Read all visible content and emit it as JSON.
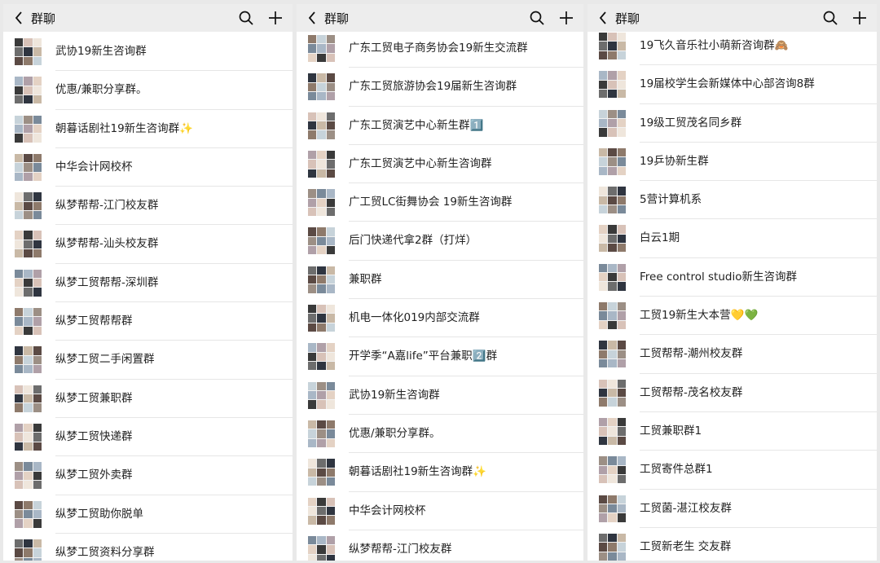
{
  "panels": [
    {
      "header": {
        "title": "群聊",
        "back_icon": "chevron-left-icon",
        "search_icon": "search-icon",
        "add_icon": "plus-icon"
      },
      "groups": [
        {
          "name": "武协19新生咨询群"
        },
        {
          "name": "优惠/兼职分享群。"
        },
        {
          "name": "朝暮话剧社19新生咨询群✨"
        },
        {
          "name": "中华会计网校杯"
        },
        {
          "name": "纵梦帮帮-江门校友群"
        },
        {
          "name": "纵梦帮帮-汕头校友群"
        },
        {
          "name": "纵梦工贸帮帮-深圳群"
        },
        {
          "name": "纵梦工贸帮帮群"
        },
        {
          "name": "纵梦工贸二手闲置群"
        },
        {
          "name": "纵梦工贸兼职群"
        },
        {
          "name": "纵梦工贸快递群"
        },
        {
          "name": "纵梦工贸外卖群"
        },
        {
          "name": "纵梦工贸助你脱单"
        },
        {
          "name": "纵梦工贸资料分享群"
        }
      ]
    },
    {
      "header": {
        "title": "群聊",
        "back_icon": "chevron-left-icon",
        "search_icon": "search-icon",
        "add_icon": "plus-icon"
      },
      "groups": [
        {
          "name": "广东工贸电子商务协会19新生交流群"
        },
        {
          "name": "广东工贸旅游协会19届新生咨询群"
        },
        {
          "name": "广东工贸演艺中心新生群1️⃣"
        },
        {
          "name": "广东工贸演艺中心新生咨询群"
        },
        {
          "name": "广工贸LC街舞协会 19新生咨询群"
        },
        {
          "name": "后门快递代拿2群（打烊）"
        },
        {
          "name": "兼职群"
        },
        {
          "name": "机电一体化019内部交流群"
        },
        {
          "name": "开学季“A嘉life”平台兼职2️⃣群"
        },
        {
          "name": "武协19新生咨询群"
        },
        {
          "name": "优惠/兼职分享群。"
        },
        {
          "name": "朝暮话剧社19新生咨询群✨"
        },
        {
          "name": "中华会计网校杯"
        },
        {
          "name": "纵梦帮帮-江门校友群"
        }
      ]
    },
    {
      "header": {
        "title": "群聊",
        "back_icon": "chevron-left-icon",
        "search_icon": "search-icon",
        "add_icon": "plus-icon"
      },
      "groups": [
        {
          "name": "19飞久音乐社小萌新咨询群🙈"
        },
        {
          "name": "19届校学生会新媒体中心部咨询8群"
        },
        {
          "name": "19级工贸茂名同乡群"
        },
        {
          "name": "19乒协新生群"
        },
        {
          "name": "5营计算机系"
        },
        {
          "name": "白云1期"
        },
        {
          "name": "Free control studio新生咨询群"
        },
        {
          "name": "工贸19新生大本营💛💚"
        },
        {
          "name": "工贸帮帮-潮州校友群"
        },
        {
          "name": "工贸帮帮-茂名校友群"
        },
        {
          "name": "工贸兼职群1"
        },
        {
          "name": "工贸寄件总群1"
        },
        {
          "name": "工贸菌-湛江校友群"
        },
        {
          "name": "工贸新老生 交友群"
        }
      ]
    }
  ],
  "avatar_palette": [
    "#3a3a3a",
    "#c9b9a6",
    "#7a8a9a",
    "#d8c2b8",
    "#5b4a44",
    "#a9b7c6",
    "#efe6dc",
    "#8e7a6b",
    "#b0a0a8",
    "#6d6d6d",
    "#c7d3da",
    "#e4d2c4",
    "#2f3540",
    "#9c8f85"
  ]
}
